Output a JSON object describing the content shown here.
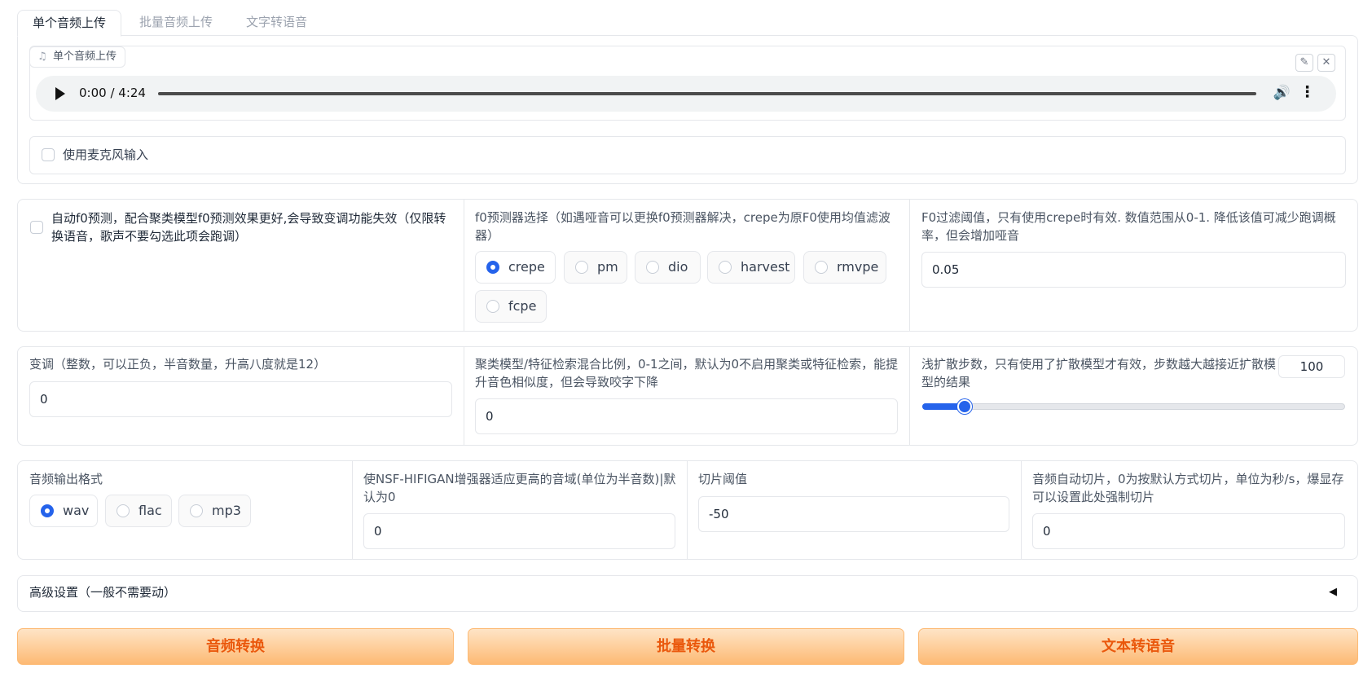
{
  "tabs": [
    {
      "label": "单个音频上传"
    },
    {
      "label": "批量音频上传"
    },
    {
      "label": "文字转语音"
    }
  ],
  "audio_panel": {
    "label": "单个音频上传",
    "note_icon": "♫",
    "edit_icon": "✎",
    "close_icon": "✕",
    "player": {
      "time": "0:00 / 4:24",
      "volume_icon": "🔊",
      "more_icon": "⋮"
    }
  },
  "mic": {
    "label": "使用麦克风输入",
    "checked": false
  },
  "auto_f0": {
    "label": "自动f0预测，配合聚类模型f0预测效果更好,会导致变调功能失效（仅限转换语音，歌声不要勾选此项会跑调）",
    "checked": false
  },
  "f0_predictor": {
    "label": "f0预测器选择（如遇哑音可以更换f0预测器解决，crepe为原F0使用均值滤波器）",
    "options": [
      "crepe",
      "pm",
      "dio",
      "harvest",
      "rmvpe",
      "fcpe"
    ],
    "selected": "crepe"
  },
  "f0_filter": {
    "label": "F0过滤阈值，只有使用crepe时有效. 数值范围从0-1. 降低该值可减少跑调概率，但会增加哑音",
    "value": "0.05"
  },
  "transpose": {
    "label": "变调（整数，可以正负，半音数量，升高八度就是12）",
    "value": "0"
  },
  "cluster_ratio": {
    "label": "聚类模型/特征检索混合比例，0-1之间，默认为0不启用聚类或特征检索，能提升音色相似度，但会导致咬字下降",
    "value": "0"
  },
  "diffusion_steps": {
    "label": "浅扩散步数，只有使用了扩散模型才有效，步数越大越接近扩散模型的结果",
    "value": "100",
    "min": 1,
    "max": 1000,
    "fraction": 0.1
  },
  "output_format": {
    "label": "音频输出格式",
    "options": [
      "wav",
      "flac",
      "mp3"
    ],
    "selected": "wav"
  },
  "nsf_hifigan": {
    "label": "使NSF-HIFIGAN增强器适应更高的音域(单位为半音数)|默认为0",
    "value": "0"
  },
  "slice_threshold": {
    "label": "切片阈值",
    "value": "-50"
  },
  "auto_slice": {
    "label": "音频自动切片，0为按默认方式切片，单位为秒/s，爆显存可以设置此处强制切片",
    "value": "0"
  },
  "advanced": {
    "label": "高级设置（一般不需要动）",
    "toggle_icon": "◀"
  },
  "actions": {
    "convert": "音频转换",
    "batch": "批量转换",
    "tts": "文本转语音"
  },
  "colors": {
    "accent": "#2563eb",
    "button_text": "#ea580c",
    "button_bg": "#fdba74"
  }
}
